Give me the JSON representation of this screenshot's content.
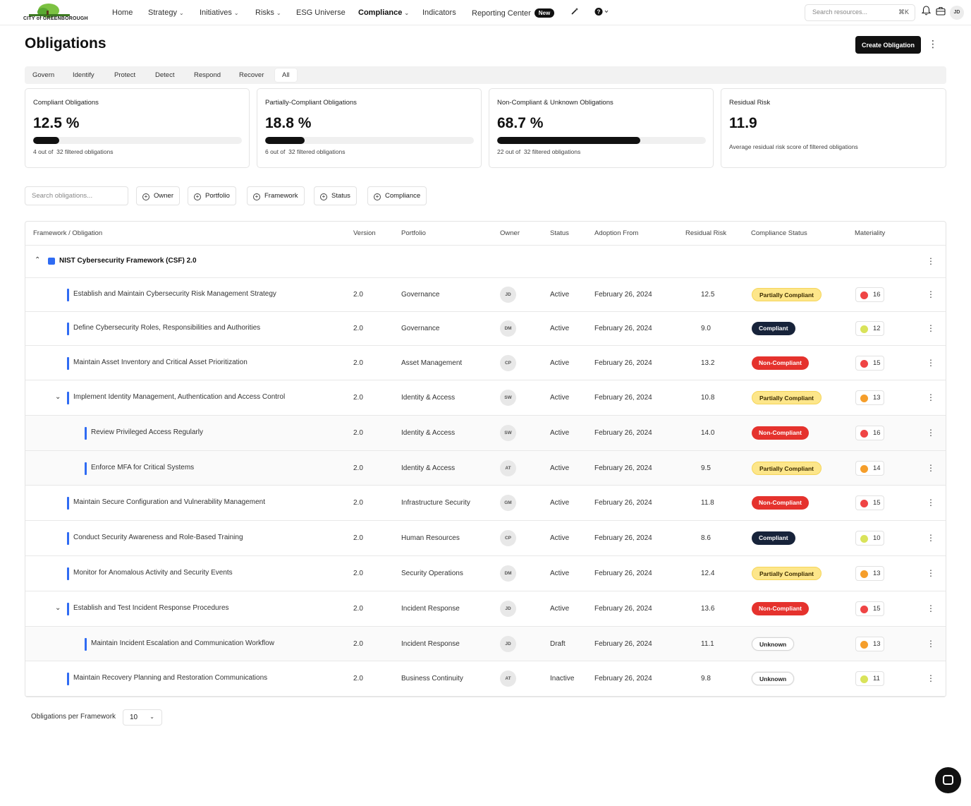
{
  "brand": {
    "logo_text": "CITY of GREENBOROUGH"
  },
  "nav": {
    "items": [
      {
        "label": "Home",
        "has_caret": false
      },
      {
        "label": "Strategy",
        "has_caret": true
      },
      {
        "label": "Initiatives",
        "has_caret": true
      },
      {
        "label": "Risks",
        "has_caret": true
      },
      {
        "label": "ESG Universe",
        "has_caret": false
      },
      {
        "label": "Compliance",
        "has_caret": true,
        "active": true
      },
      {
        "label": "Indicators",
        "has_caret": false
      },
      {
        "label": "Reporting Center",
        "has_caret": false,
        "badge": "New"
      }
    ],
    "search_placeholder": "Search resources...",
    "search_shortcut": "⌘K",
    "user_initials": "JD"
  },
  "page": {
    "title": "Obligations",
    "create_button": "Create Obligation"
  },
  "tabs": [
    "Govern",
    "Identify",
    "Protect",
    "Detect",
    "Respond",
    "Recover",
    "All"
  ],
  "active_tab": "All",
  "cards": [
    {
      "title": "Compliant Obligations",
      "value": "12.5 %",
      "progress": 0.125,
      "count": "4",
      "total": "32",
      "sub_mid": "out of",
      "sub_end": "filtered obligations"
    },
    {
      "title": "Partially-Compliant Obligations",
      "value": "18.8 %",
      "progress": 0.188,
      "count": "6",
      "total": "32",
      "sub_mid": "out of",
      "sub_end": "filtered obligations"
    },
    {
      "title": "Non-Compliant & Unknown Obligations",
      "value": "68.7 %",
      "progress": 0.687,
      "count": "22",
      "total": "32",
      "sub_mid": "out of",
      "sub_end": "filtered obligations"
    },
    {
      "title": "Residual Risk",
      "value": "11.9",
      "description": "Average residual risk score of filtered obligations"
    }
  ],
  "filters": {
    "search_placeholder": "Search obligations...",
    "buttons": [
      "Owner",
      "Portfolio",
      "Framework",
      "Status",
      "Compliance"
    ]
  },
  "table": {
    "columns": [
      "Framework / Obligation",
      "Version",
      "Portfolio",
      "Owner",
      "Status",
      "Adoption From",
      "Residual Risk",
      "Compliance Status",
      "Materiality"
    ],
    "framework": "NIST Cybersecurity Framework (CSF) 2.0",
    "rows": [
      {
        "name": "Establish and Maintain Cybersecurity Risk Management Strategy",
        "level": 1,
        "expandable": false,
        "version": "2.0",
        "portfolio": "Governance",
        "owner": "JD",
        "status": "Active",
        "adoption": "February 26, 2024",
        "risk": "12.5",
        "compliance": "Partially Compliant",
        "compliance_kind": "partial",
        "materiality": "16",
        "mat_color": "#ef4444"
      },
      {
        "name": "Define Cybersecurity Roles, Responsibilities and Authorities",
        "level": 1,
        "expandable": false,
        "version": "2.0",
        "portfolio": "Governance",
        "owner": "DM",
        "status": "Active",
        "adoption": "February 26, 2024",
        "risk": "9.0",
        "compliance": "Compliant",
        "compliance_kind": "compliant",
        "materiality": "12",
        "mat_color": "#d9e35a"
      },
      {
        "name": "Maintain Asset Inventory and Critical Asset Prioritization",
        "level": 1,
        "expandable": false,
        "version": "2.0",
        "portfolio": "Asset Management",
        "owner": "CP",
        "status": "Active",
        "adoption": "February 26, 2024",
        "risk": "13.2",
        "compliance": "Non-Compliant",
        "compliance_kind": "noncompliant",
        "materiality": "15",
        "mat_color": "#ef4444"
      },
      {
        "name": "Implement Identity Management, Authentication and Access Control",
        "level": 1,
        "expandable": true,
        "version": "2.0",
        "portfolio": "Identity & Access",
        "owner": "SW",
        "status": "Active",
        "adoption": "February 26, 2024",
        "risk": "10.8",
        "compliance": "Partially Compliant",
        "compliance_kind": "partial",
        "materiality": "13",
        "mat_color": "#f59e2b"
      },
      {
        "name": "Review Privileged Access Regularly",
        "level": 2,
        "expandable": false,
        "version": "2.0",
        "portfolio": "Identity & Access",
        "owner": "SW",
        "status": "Active",
        "adoption": "February 26, 2024",
        "risk": "14.0",
        "compliance": "Non-Compliant",
        "compliance_kind": "noncompliant",
        "materiality": "16",
        "mat_color": "#ef4444"
      },
      {
        "name": "Enforce MFA for Critical Systems",
        "level": 2,
        "expandable": false,
        "version": "2.0",
        "portfolio": "Identity & Access",
        "owner": "AT",
        "status": "Active",
        "adoption": "February 26, 2024",
        "risk": "9.5",
        "compliance": "Partially Compliant",
        "compliance_kind": "partial",
        "materiality": "14",
        "mat_color": "#f59e2b"
      },
      {
        "name": "Maintain Secure Configuration and Vulnerability Management",
        "level": 1,
        "expandable": false,
        "version": "2.0",
        "portfolio": "Infrastructure Security",
        "owner": "GM",
        "status": "Active",
        "adoption": "February 26, 2024",
        "risk": "11.8",
        "compliance": "Non-Compliant",
        "compliance_kind": "noncompliant",
        "materiality": "15",
        "mat_color": "#ef4444"
      },
      {
        "name": "Conduct Security Awareness and Role-Based Training",
        "level": 1,
        "expandable": false,
        "version": "2.0",
        "portfolio": "Human Resources",
        "owner": "CP",
        "status": "Active",
        "adoption": "February 26, 2024",
        "risk": "8.6",
        "compliance": "Compliant",
        "compliance_kind": "compliant",
        "materiality": "10",
        "mat_color": "#d9e35a"
      },
      {
        "name": "Monitor for Anomalous Activity and Security Events",
        "level": 1,
        "expandable": false,
        "version": "2.0",
        "portfolio": "Security Operations",
        "owner": "DM",
        "status": "Active",
        "adoption": "February 26, 2024",
        "risk": "12.4",
        "compliance": "Partially Compliant",
        "compliance_kind": "partial",
        "materiality": "13",
        "mat_color": "#f59e2b"
      },
      {
        "name": "Establish and Test Incident Response Procedures",
        "level": 1,
        "expandable": true,
        "version": "2.0",
        "portfolio": "Incident Response",
        "owner": "JD",
        "status": "Active",
        "adoption": "February 26, 2024",
        "risk": "13.6",
        "compliance": "Non-Compliant",
        "compliance_kind": "noncompliant",
        "materiality": "15",
        "mat_color": "#ef4444"
      },
      {
        "name": "Maintain Incident Escalation and Communication Workflow",
        "level": 2,
        "expandable": false,
        "version": "2.0",
        "portfolio": "Incident Response",
        "owner": "JD",
        "status": "Draft",
        "adoption": "February 26, 2024",
        "risk": "11.1",
        "compliance": "Unknown",
        "compliance_kind": "unknown",
        "materiality": "13",
        "mat_color": "#f59e2b"
      },
      {
        "name": "Maintain Recovery Planning and Restoration Communications",
        "level": 1,
        "expandable": false,
        "version": "2.0",
        "portfolio": "Business Continuity",
        "owner": "AT",
        "status": "Inactive",
        "adoption": "February 26, 2024",
        "risk": "9.8",
        "compliance": "Unknown",
        "compliance_kind": "unknown",
        "materiality": "11",
        "mat_color": "#d9e35a"
      }
    ]
  },
  "footer": {
    "per_label": "Obligations per Framework",
    "per_value": "10"
  },
  "colors": {
    "accent_blue": "#2f6bf3",
    "compliant": "#17233a",
    "non_compliant": "#e5322d",
    "partial": "#fde68a"
  },
  "icons": [
    "wand-icon",
    "help-icon",
    "bell-icon",
    "briefcase-icon",
    "chat-icon"
  ]
}
